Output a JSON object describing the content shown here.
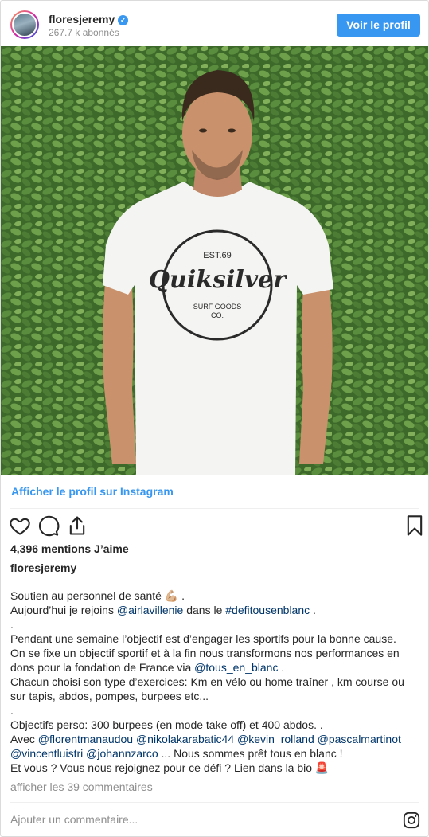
{
  "header": {
    "username": "floresjeremy",
    "followers": "267.7 k abonnés",
    "view_profile_button": "Voir le profil"
  },
  "view_on_instagram": "Afficher le profil sur Instagram",
  "likes": "4,396 mentions J’aime",
  "author": "floresjeremy",
  "caption": {
    "l1": "Soutien au personnel de santé 💪🏼 .",
    "l2_pre": "Aujourd’hui je rejoins ",
    "l2_m1": "@airlavillenie",
    "l2_mid": " dans le ",
    "l2_tag": "#defitousenblanc",
    "l2_post": " .",
    "l3": ".",
    "l4": "Pendant une semaine l’objectif est d’engager les sportifs pour la bonne cause.",
    "l5": "On se fixe un objectif sportif et à la fin nous transformons nos performances en",
    "l6_pre": "dons pour la fondation de France via ",
    "l6_m": "@tous_en_blanc",
    "l6_post": " .",
    "l7": "Chacun choisi son type d’exercices: Km en vélo ou home traîner , km course ou",
    "l8": "sur tapis, abdos, pompes, burpees etc...",
    "l9": ".",
    "l10": "Objectifs perso: 300 burpees (en mode take off) et 400 abdos. .",
    "l11_pre": "Avec ",
    "l11_m1": "@florentmanaudou",
    "l11_m2": "@nikolakarabatic44",
    "l11_m3": "@kevin_rolland",
    "l11_m4": "@pascalmartinot",
    "l12_m1": "@vincentluistri",
    "l12_m2": "@johannzarco",
    "l12_post": " ... Nous sommes prêt tous en blanc !",
    "l13": "Et vous ? Vous nous rejoignez pour ce défi ? Lien dans la bio 🚨"
  },
  "comments_link": "afficher les 39 commentaires",
  "add_comment_placeholder": "Ajouter un commentaire...",
  "icons": {
    "like": "heart-icon",
    "comment": "comment-icon",
    "share": "share-icon",
    "save": "bookmark-icon",
    "instagram": "instagram-logo-icon",
    "verified": "verified-badge-icon"
  },
  "photo": {
    "shirt_brand": "Quiksilver",
    "shirt_top": "EST.69",
    "shirt_bottom1": "SURF GOODS",
    "shirt_bottom2": "CO."
  },
  "colors": {
    "accent": "#3897f0",
    "mention": "#003569",
    "muted": "#8e8e8e"
  }
}
